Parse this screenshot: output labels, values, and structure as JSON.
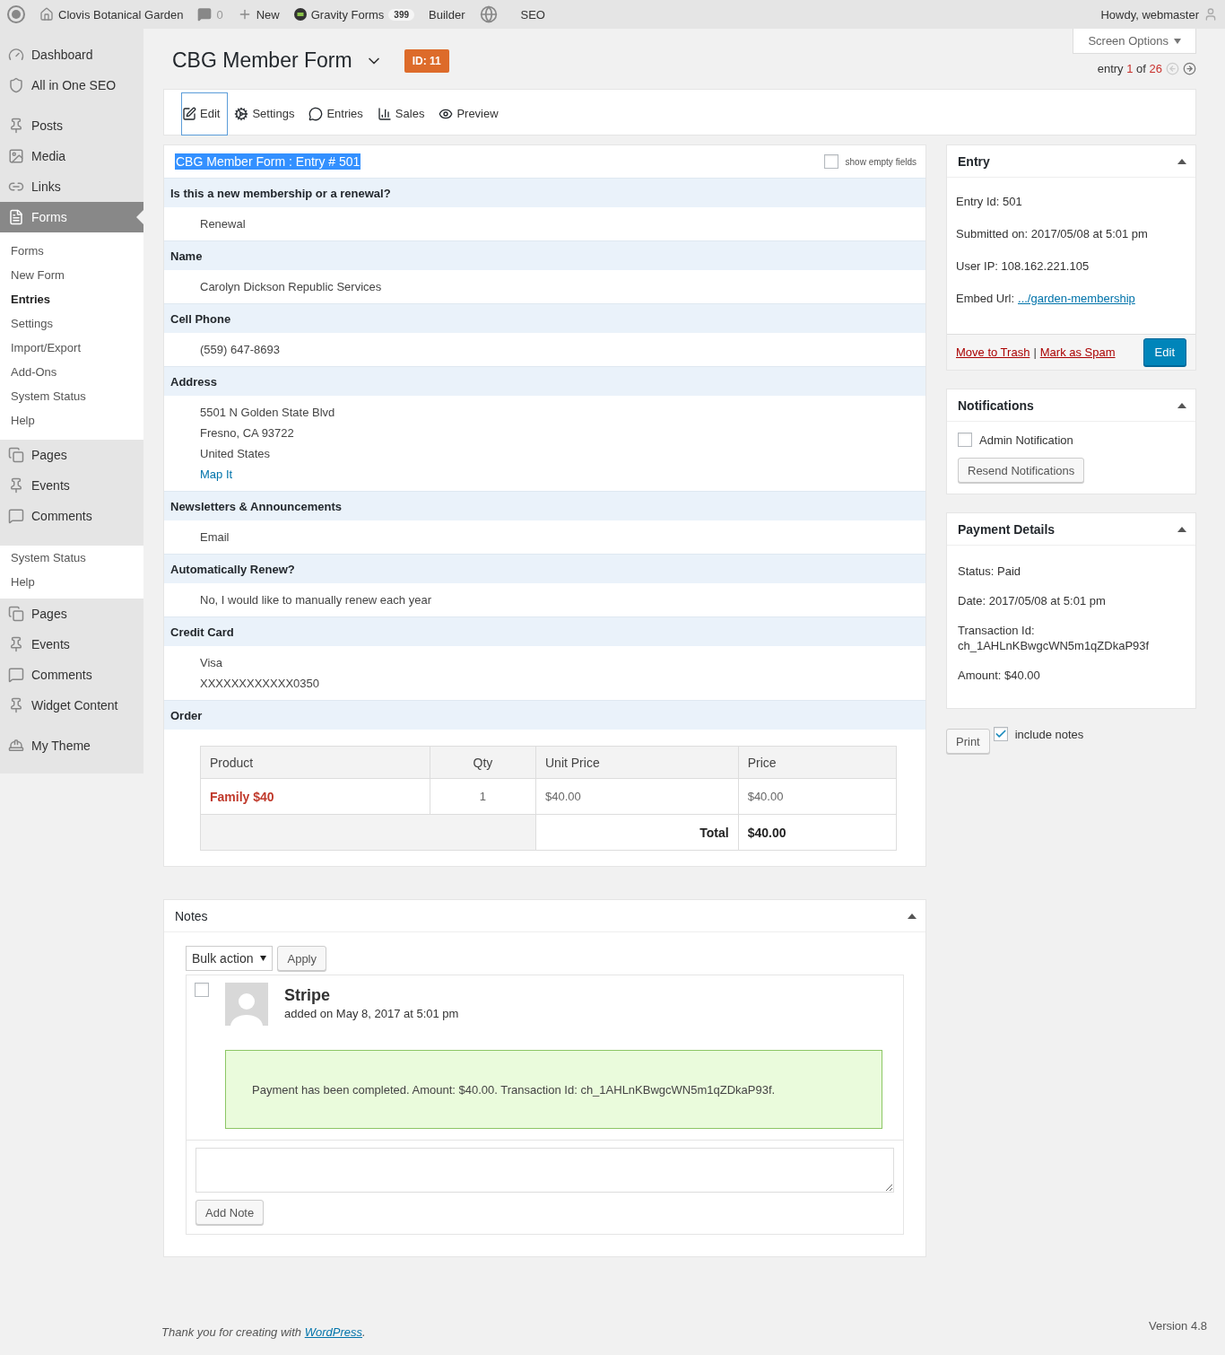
{
  "admin_bar": {
    "site_name": "Clovis Botanical Garden",
    "comment_count": "0",
    "new_label": "New",
    "forms_label": "Gravity Forms",
    "forms_badge": "399",
    "builder_label": "Builder",
    "seo_label": "SEO",
    "greeting": "Howdy, webmaster"
  },
  "sidebar": [
    {
      "kind": "menu",
      "items": [
        {
          "label": "Dashboard",
          "selected": false
        },
        {
          "label": "All in One SEO",
          "selected": false
        }
      ]
    },
    {
      "kind": "separator"
    },
    {
      "kind": "menu",
      "items": [
        {
          "label": "Posts",
          "selected": false
        },
        {
          "label": "Media",
          "selected": false
        },
        {
          "label": "Links",
          "selected": false
        },
        {
          "label": "Forms",
          "selected": true
        }
      ]
    },
    {
      "kind": "submenu",
      "items": [
        {
          "label": "Forms",
          "current": false
        },
        {
          "label": "New Form",
          "current": false
        },
        {
          "label": "Entries",
          "current": true
        },
        {
          "label": "Settings",
          "current": false
        },
        {
          "label": "Import/Export",
          "current": false
        },
        {
          "label": "Add-Ons",
          "current": false
        },
        {
          "label": "System Status",
          "current": false
        },
        {
          "label": "Help",
          "current": false
        }
      ]
    },
    {
      "kind": "menu",
      "items": [
        {
          "label": "Pages",
          "selected": false
        },
        {
          "label": "Events",
          "selected": false
        },
        {
          "label": "Comments",
          "selected": false
        }
      ]
    },
    {
      "kind": "separator"
    },
    {
      "kind": "submenu",
      "items": [
        {
          "label": "System Status",
          "current": false
        },
        {
          "label": "Help",
          "current": false
        }
      ]
    },
    {
      "kind": "menu",
      "items": [
        {
          "label": "Pages",
          "selected": false
        },
        {
          "label": "Events",
          "selected": false
        },
        {
          "label": "Comments",
          "selected": false
        },
        {
          "label": "Widget Content",
          "selected": false
        }
      ]
    },
    {
      "kind": "separator"
    },
    {
      "kind": "menu",
      "items": [
        {
          "label": "My Theme",
          "selected": false
        }
      ]
    }
  ],
  "header": {
    "title": "CBG Member Form",
    "id_badge": "ID: 11",
    "screen_options": "Screen Options",
    "entry_nav": {
      "prefix": "entry",
      "current": "1",
      "middle": "of",
      "total": "26"
    }
  },
  "toolbar": [
    {
      "label": "Edit",
      "selected": true
    },
    {
      "label": "Settings",
      "selected": false
    },
    {
      "label": "Entries",
      "selected": false
    },
    {
      "label": "Sales",
      "selected": false
    },
    {
      "label": "Preview",
      "selected": false
    }
  ],
  "entry_detail": {
    "title": "CBG Member Form : Entry # 501",
    "title_highlighted": true,
    "show_empty": {
      "label": "show empty fields",
      "checked": false
    },
    "fields": [
      {
        "label": "Is this a new membership or a renewal?",
        "kind": "text",
        "lines": [
          {
            "text": "Renewal",
            "link": false
          }
        ]
      },
      {
        "label": "Name",
        "kind": "text",
        "lines": [
          {
            "text": "Carolyn Dickson Republic Services",
            "link": false
          }
        ]
      },
      {
        "label": "Cell Phone",
        "kind": "text",
        "lines": [
          {
            "text": "(559) 647-8693",
            "link": false
          }
        ]
      },
      {
        "label": "Address",
        "kind": "text",
        "lines": [
          {
            "text": "5501 N Golden State Blvd",
            "link": false
          },
          {
            "text": "Fresno, CA 93722",
            "link": false
          },
          {
            "text": "United States",
            "link": false
          },
          {
            "text": "Map It",
            "link": true
          }
        ]
      },
      {
        "label": "Newsletters & Announcements",
        "kind": "text",
        "lines": [
          {
            "text": "Email",
            "link": false
          }
        ]
      },
      {
        "label": "Automatically Renew?",
        "kind": "text",
        "lines": [
          {
            "text": "No, I would like to manually renew each year",
            "link": false
          }
        ]
      },
      {
        "label": "Credit Card",
        "kind": "text",
        "lines": [
          {
            "text": "Visa",
            "link": false
          },
          {
            "text": "XXXXXXXXXXXX0350",
            "link": false
          }
        ]
      },
      {
        "label": "Order",
        "kind": "order",
        "table": {
          "columns": [
            "Product",
            "Qty",
            "Unit Price",
            "Price"
          ],
          "rows": [
            [
              "Family $40",
              "1",
              "$40.00",
              "$40.00"
            ]
          ],
          "total_label": "Total",
          "total": "$40.00"
        }
      }
    ]
  },
  "notes": {
    "title": "Notes",
    "bulk_action": "Bulk action",
    "apply": "Apply",
    "items": [
      {
        "checked": false,
        "author": "Stripe",
        "meta": "added on May 8, 2017 at 5:01 pm",
        "kind": "success",
        "text": "Payment has been completed. Amount: $40.00. Transaction Id: ch_1AHLnKBwgcWN5m1qZDkaP93f."
      }
    ],
    "add_note": "Add Note"
  },
  "entry_box": {
    "title": "Entry",
    "lines": [
      {
        "text": "Entry Id: 501"
      },
      {
        "text": "Submitted on: 2017/05/08 at 5:01 pm"
      },
      {
        "text": "User IP: 108.162.221.105"
      },
      {
        "text": "Embed Url:",
        "link": ".../garden-membership"
      }
    ],
    "trash": "Move to Trash",
    "separator": "|",
    "spam": "Mark as Spam",
    "edit": "Edit"
  },
  "notifications": {
    "title": "Notifications",
    "items": [
      {
        "label": "Admin Notification",
        "checked": false
      }
    ],
    "button": "Resend Notifications"
  },
  "payment": {
    "title": "Payment Details",
    "lines": [
      {
        "text": "Status: Paid"
      },
      {
        "text": "Date: 2017/05/08 at 5:01 pm"
      },
      {
        "text": "Transaction Id:",
        "second_line": "ch_1AHLnKBwgcWN5m1qZDkaP93f"
      },
      {
        "text": "Amount: $40.00"
      }
    ]
  },
  "print": {
    "button": "Print",
    "include_notes": {
      "label": "include notes",
      "checked": true
    }
  },
  "footer": {
    "credit": "Thank you for creating with",
    "link": "WordPress",
    "end": ".",
    "version": "Version 4.8"
  }
}
